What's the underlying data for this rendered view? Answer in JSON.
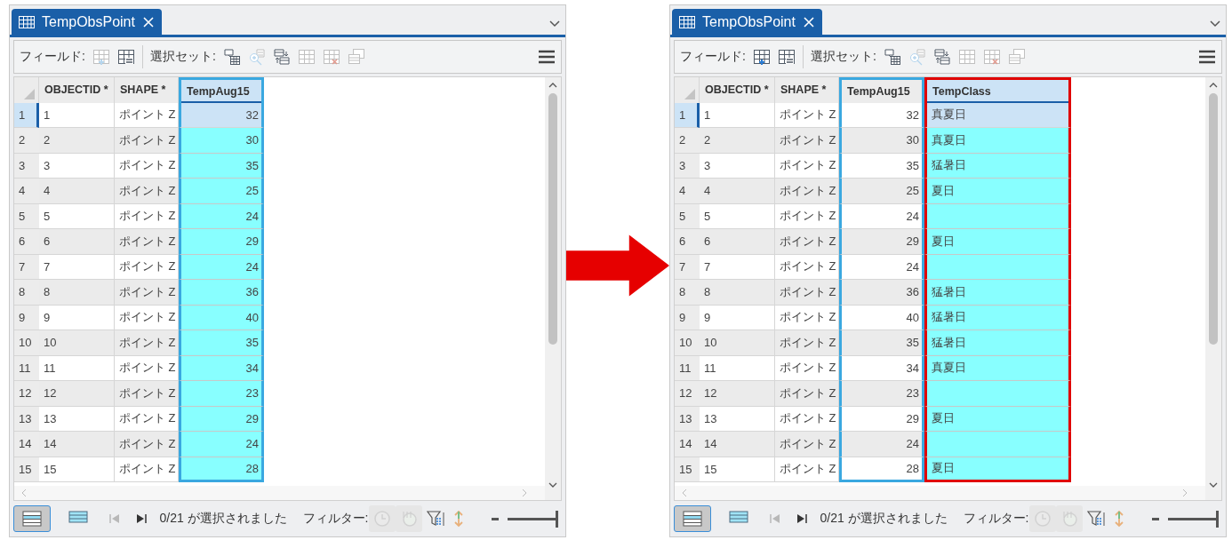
{
  "panels": [
    {
      "tab": {
        "title": "TempObsPoint",
        "selected": true
      },
      "toolbar": {
        "field_label": "フィールド:",
        "field_tools": [
          {
            "kind": "add-field",
            "disabled": true
          },
          {
            "kind": "calculate-field",
            "disabled": false
          }
        ],
        "selection_label": "選択セット:",
        "selection_tools": [
          {
            "kind": "select-by-attributes",
            "disabled": false
          },
          {
            "kind": "zoom-to",
            "disabled": true
          },
          {
            "kind": "switch",
            "disabled": false
          },
          {
            "kind": "clear",
            "disabled": true
          },
          {
            "kind": "delete",
            "disabled": true
          },
          {
            "kind": "copy",
            "disabled": true
          }
        ]
      },
      "columns": [
        {
          "label": "OBJECTID *",
          "kind": "id",
          "selected": false
        },
        {
          "label": "SHAPE *",
          "kind": "shape",
          "selected": false
        },
        {
          "label": "TempAug15",
          "kind": "number",
          "selected": true,
          "color": "#3aa8e0"
        }
      ],
      "rows": [
        {
          "num": "1",
          "current": true,
          "cells": [
            "1",
            "ポイント Z",
            "32"
          ]
        },
        {
          "num": "2",
          "current": false,
          "cells": [
            "2",
            "ポイント Z",
            "30"
          ]
        },
        {
          "num": "3",
          "current": false,
          "cells": [
            "3",
            "ポイント Z",
            "35"
          ]
        },
        {
          "num": "4",
          "current": false,
          "cells": [
            "4",
            "ポイント Z",
            "25"
          ]
        },
        {
          "num": "5",
          "current": false,
          "cells": [
            "5",
            "ポイント Z",
            "24"
          ]
        },
        {
          "num": "6",
          "current": false,
          "cells": [
            "6",
            "ポイント Z",
            "29"
          ]
        },
        {
          "num": "7",
          "current": false,
          "cells": [
            "7",
            "ポイント Z",
            "24"
          ]
        },
        {
          "num": "8",
          "current": false,
          "cells": [
            "8",
            "ポイント Z",
            "36"
          ]
        },
        {
          "num": "9",
          "current": false,
          "cells": [
            "9",
            "ポイント Z",
            "40"
          ]
        },
        {
          "num": "10",
          "current": false,
          "cells": [
            "10",
            "ポイント Z",
            "35"
          ]
        },
        {
          "num": "11",
          "current": false,
          "cells": [
            "11",
            "ポイント Z",
            "34"
          ]
        },
        {
          "num": "12",
          "current": false,
          "cells": [
            "12",
            "ポイント Z",
            "23"
          ]
        },
        {
          "num": "13",
          "current": false,
          "cells": [
            "13",
            "ポイント Z",
            "29"
          ]
        },
        {
          "num": "14",
          "current": false,
          "cells": [
            "14",
            "ポイント Z",
            "24"
          ]
        },
        {
          "num": "15",
          "current": false,
          "cells": [
            "15",
            "ポイント Z",
            "28"
          ]
        }
      ],
      "footer": {
        "views": [
          {
            "kind": "all",
            "selected": true
          },
          {
            "kind": "selected",
            "selected": false
          }
        ],
        "nav": [
          {
            "kind": "first",
            "disabled": true
          },
          {
            "kind": "last",
            "disabled": false
          }
        ],
        "status": "0/21 が選択されました",
        "filter_label": "フィルター:",
        "filters": [
          {
            "kind": "time",
            "disabled": true
          },
          {
            "kind": "range",
            "disabled": true
          },
          {
            "kind": "extent",
            "disabled": false
          },
          {
            "kind": "row-height",
            "disabled": false
          }
        ],
        "zoom": {
          "level": 1
        }
      }
    },
    {
      "tab": {
        "title": "TempObsPoint",
        "selected": true
      },
      "toolbar": {
        "field_label": "フィールド:",
        "field_tools": [
          {
            "kind": "add-field",
            "disabled": false
          },
          {
            "kind": "calculate-field",
            "disabled": false
          }
        ],
        "selection_label": "選択セット:",
        "selection_tools": [
          {
            "kind": "select-by-attributes",
            "disabled": false
          },
          {
            "kind": "zoom-to",
            "disabled": true
          },
          {
            "kind": "switch",
            "disabled": false
          },
          {
            "kind": "clear",
            "disabled": true
          },
          {
            "kind": "delete",
            "disabled": true
          },
          {
            "kind": "copy",
            "disabled": true
          }
        ]
      },
      "columns": [
        {
          "label": "OBJECTID *",
          "kind": "id",
          "selected": false
        },
        {
          "label": "SHAPE *",
          "kind": "shape",
          "selected": false
        },
        {
          "label": "TempAug15",
          "kind": "number",
          "selected": false,
          "color": "#3aa8e0"
        },
        {
          "label": "TempClass",
          "kind": "text",
          "selected": true,
          "color": "#e00000"
        }
      ],
      "rows": [
        {
          "num": "1",
          "current": true,
          "cells": [
            "1",
            "ポイント Z",
            "32",
            "真夏日"
          ]
        },
        {
          "num": "2",
          "current": false,
          "cells": [
            "2",
            "ポイント Z",
            "30",
            "真夏日"
          ]
        },
        {
          "num": "3",
          "current": false,
          "cells": [
            "3",
            "ポイント Z",
            "35",
            "猛暑日"
          ]
        },
        {
          "num": "4",
          "current": false,
          "cells": [
            "4",
            "ポイント Z",
            "25",
            "夏日"
          ]
        },
        {
          "num": "5",
          "current": false,
          "cells": [
            "5",
            "ポイント Z",
            "24",
            null
          ]
        },
        {
          "num": "6",
          "current": false,
          "cells": [
            "6",
            "ポイント Z",
            "29",
            "夏日"
          ]
        },
        {
          "num": "7",
          "current": false,
          "cells": [
            "7",
            "ポイント Z",
            "24",
            null
          ]
        },
        {
          "num": "8",
          "current": false,
          "cells": [
            "8",
            "ポイント Z",
            "36",
            "猛暑日"
          ]
        },
        {
          "num": "9",
          "current": false,
          "cells": [
            "9",
            "ポイント Z",
            "40",
            "猛暑日"
          ]
        },
        {
          "num": "10",
          "current": false,
          "cells": [
            "10",
            "ポイント Z",
            "35",
            "猛暑日"
          ]
        },
        {
          "num": "11",
          "current": false,
          "cells": [
            "11",
            "ポイント Z",
            "34",
            "真夏日"
          ]
        },
        {
          "num": "12",
          "current": false,
          "cells": [
            "12",
            "ポイント Z",
            "23",
            null
          ]
        },
        {
          "num": "13",
          "current": false,
          "cells": [
            "13",
            "ポイント Z",
            "29",
            "夏日"
          ]
        },
        {
          "num": "14",
          "current": false,
          "cells": [
            "14",
            "ポイント Z",
            "24",
            null
          ]
        },
        {
          "num": "15",
          "current": false,
          "cells": [
            "15",
            "ポイント Z",
            "28",
            "夏日"
          ]
        }
      ],
      "footer": {
        "views": [
          {
            "kind": "all",
            "selected": true
          },
          {
            "kind": "selected",
            "selected": false
          }
        ],
        "nav": [
          {
            "kind": "first",
            "disabled": true
          },
          {
            "kind": "last",
            "disabled": false
          }
        ],
        "status": "0/21 が選択されました",
        "filter_label": "フィルター:",
        "filters": [
          {
            "kind": "time",
            "disabled": true
          },
          {
            "kind": "range",
            "disabled": true
          },
          {
            "kind": "extent",
            "disabled": false
          },
          {
            "kind": "row-height",
            "disabled": false
          }
        ],
        "zoom": {
          "level": 1
        }
      }
    }
  ]
}
